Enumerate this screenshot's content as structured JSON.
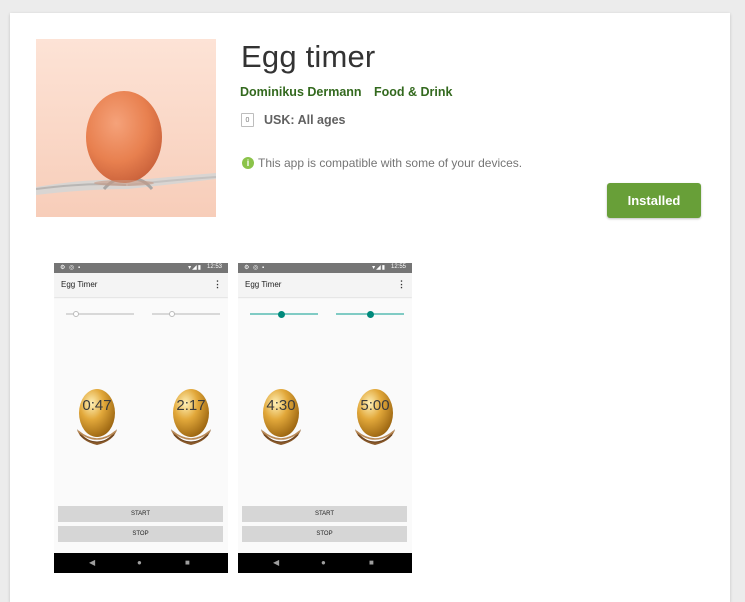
{
  "app": {
    "title": "Egg timer",
    "developer": "Dominikus Dermann",
    "category": "Food & Drink",
    "rating_badge": "0",
    "rating_label": "USK: All ages",
    "compatibility": "This app is compatible with some of your devices.",
    "install_label": "Installed",
    "install_color": "#689f38",
    "link_color": "#33691e"
  },
  "screenshots": [
    {
      "status_time": "12:53",
      "app_title": "Egg Timer",
      "menu": "⋮",
      "timer_left": "0:47",
      "timer_right": "2:17",
      "start_label": "START",
      "stop_label": "STOP",
      "slider_left": 0.15,
      "slider_right": 0.3,
      "sliders_active": false
    },
    {
      "status_time": "12:55",
      "app_title": "Egg Timer",
      "menu": "⋮",
      "timer_left": "4:30",
      "timer_right": "5:00",
      "start_label": "START",
      "stop_label": "STOP",
      "slider_left": 0.45,
      "slider_right": 0.5,
      "sliders_active": true
    }
  ],
  "nav": {
    "back": "◀",
    "home": "●",
    "recent": "■"
  },
  "icons": {
    "status_left": "settings-icon, sync-icon, sim-icon",
    "status_right": "wifi-icon, signal-icon, battery-icon"
  }
}
